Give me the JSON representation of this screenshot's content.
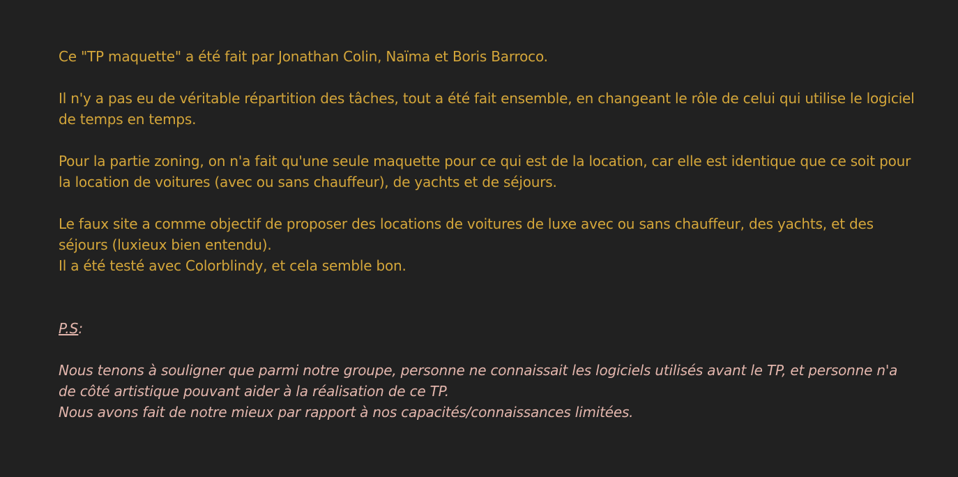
{
  "paragraphs": [
    {
      "lines": [
        "Ce \"TP maquette\" a été fait par Jonathan Colin, Naïma et Boris Barroco."
      ]
    },
    {
      "lines": [
        "Il n'y a pas eu de véritable répartition des tâches, tout a été fait ensemble, en changeant le rôle de celui qui utilise le logiciel de temps en temps."
      ]
    },
    {
      "lines": [
        "Pour la partie zoning, on n'a fait qu'une seule maquette pour ce qui est de la location, car elle est identique que ce soit pour la location de voitures (avec ou sans chauffeur), de yachts et de séjours."
      ]
    },
    {
      "lines": [
        "Le faux site a comme objectif de proposer des locations de voitures de luxe avec ou sans chauffeur, des yachts, et des séjours (luxieux bien entendu).",
        "Il a été testé avec Colorblindy, et cela semble bon."
      ]
    }
  ],
  "ps": {
    "label": "P.S",
    "colon": ":",
    "lines": [
      "Nous tenons à souligner que parmi notre groupe, personne ne connaissait les logiciels utilisés avant le TP, et personne n'a de côté artistique pouvant aider à la réalisation de ce TP.",
      "Nous avons fait de notre mieux par rapport à nos capacités/connaissances limitées."
    ]
  },
  "colors": {
    "background": "#212121",
    "main_text": "#d4a63a",
    "ps_text": "#e3b6ad"
  }
}
